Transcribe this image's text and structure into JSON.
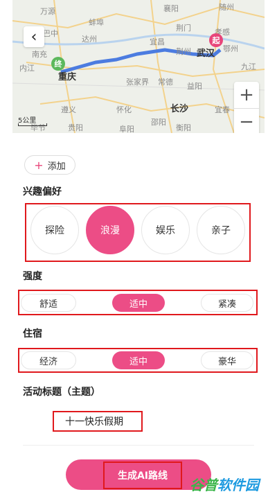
{
  "map": {
    "cities": [
      {
        "id": "wanyuan",
        "label": "万源",
        "big": false
      },
      {
        "id": "xiangyang",
        "label": "襄阳",
        "big": false
      },
      {
        "id": "suizhou",
        "label": "随州",
        "big": false
      },
      {
        "id": "bazhong",
        "label": "巴中",
        "big": false
      },
      {
        "id": "dazhou",
        "label": "达州",
        "big": false
      },
      {
        "id": "jingmen",
        "label": "荆门",
        "big": false
      },
      {
        "id": "xiaogan",
        "label": "孝感",
        "big": false
      },
      {
        "id": "nanchong",
        "label": "南充",
        "big": false
      },
      {
        "id": "yichang",
        "label": "宜昌",
        "big": false
      },
      {
        "id": "jingzhou",
        "label": "荆州",
        "big": false
      },
      {
        "id": "wuhan",
        "label": "武汉",
        "big": true
      },
      {
        "id": "ezhou",
        "label": "鄂州",
        "big": false
      },
      {
        "id": "neijiang",
        "label": "内江",
        "big": false
      },
      {
        "id": "jiujiang",
        "label": "九江",
        "big": false
      },
      {
        "id": "zhangjiajie",
        "label": "张家界",
        "big": false
      },
      {
        "id": "changde",
        "label": "常德",
        "big": false
      },
      {
        "id": "yiyang",
        "label": "益阳",
        "big": false
      },
      {
        "id": "zunyi",
        "label": "遵义",
        "big": false
      },
      {
        "id": "changsha",
        "label": "长沙",
        "big": true
      },
      {
        "id": "yichun",
        "label": "宜春",
        "big": false
      },
      {
        "id": "huaihua",
        "label": "怀化",
        "big": false
      },
      {
        "id": "shaoyang",
        "label": "邵阳",
        "big": false
      },
      {
        "id": "bijie",
        "label": "毕节",
        "big": false
      },
      {
        "id": "guiyang",
        "label": "贵阳",
        "big": false
      },
      {
        "id": "hengyang",
        "label": "衡阳",
        "big": false
      },
      {
        "id": "ji",
        "label": "吉",
        "big": false
      },
      {
        "id": "fuyang",
        "label": "阜阳",
        "big": false
      },
      {
        "id": "chongqing",
        "label": "重庆",
        "big": true
      },
      {
        "id": "bengbu",
        "label": "蚌埠",
        "big": false
      }
    ],
    "start_pin": "起",
    "end_pin": "终",
    "scale_label": "5公里",
    "zoom_in": "+",
    "zoom_out": "−",
    "back_icon": "‹"
  },
  "add_button": {
    "plus": "+",
    "label": "添加"
  },
  "interest": {
    "title": "兴趣偏好",
    "options": [
      "探险",
      "浪漫",
      "娱乐",
      "亲子"
    ],
    "selected": "浪漫"
  },
  "intensity": {
    "title": "强度",
    "options": [
      "舒适",
      "适中",
      "紧凑"
    ],
    "selected": "适中"
  },
  "lodging": {
    "title": "住宿",
    "options": [
      "经济",
      "适中",
      "豪华"
    ],
    "selected": "适中"
  },
  "activity": {
    "title": "活动标题（主题）",
    "value": "十一快乐假期"
  },
  "generate_button": {
    "label": "生成AI路线"
  },
  "watermark": {
    "part1": "谷普",
    "part2": "软件园"
  },
  "colors": {
    "accent": "#ec4d86",
    "highlight_box": "#e0181c",
    "route": "#4c7ce0",
    "start_pin": "#e8457a",
    "end_pin": "#5cb85c"
  }
}
